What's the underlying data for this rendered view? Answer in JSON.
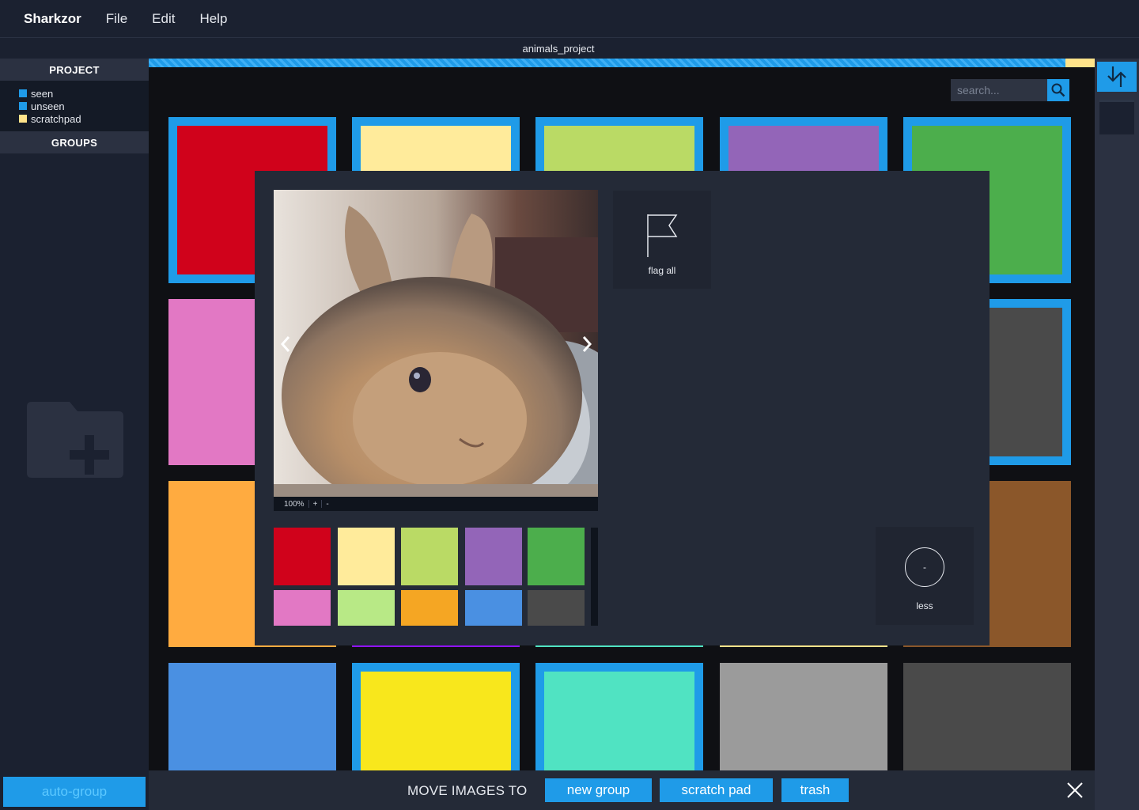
{
  "app": {
    "brand": "Sharkzor",
    "menu": [
      "File",
      "Edit",
      "Help"
    ],
    "project_title": "animals_project"
  },
  "sidebar": {
    "project_header": "PROJECT",
    "legend": [
      {
        "label": "seen",
        "color": "#1f9be8"
      },
      {
        "label": "unseen",
        "color": "#1f9be8"
      },
      {
        "label": "scratchpad",
        "color": "#ffe38a"
      }
    ],
    "groups_header": "GROUPS",
    "add_group_icon": "folder-plus-icon",
    "auto_group_label": "auto-group"
  },
  "search": {
    "placeholder": "search...",
    "icon": "search-icon"
  },
  "grid": {
    "accent": "#1f9be8",
    "tiles": [
      {
        "color": "#d0021b",
        "selected": true
      },
      {
        "color": "#ffeb9b",
        "selected": true
      },
      {
        "color": "#bada65",
        "selected": true
      },
      {
        "color": "#9365b8",
        "selected": true
      },
      {
        "color": "#4cae4c",
        "selected": true
      },
      {
        "color": "#e278c4",
        "selected": false
      },
      {
        "color": "#b8e986",
        "selected": false
      },
      {
        "color": "#f5a623",
        "selected": false
      },
      {
        "color": "#4a90e2",
        "selected": false
      },
      {
        "color": "#4a4a4a",
        "selected": true
      },
      {
        "color": "#ffab40",
        "selected": false
      },
      {
        "color": "#9013fe",
        "selected": false
      },
      {
        "color": "#50e3c2",
        "selected": false
      },
      {
        "color": "#ffe38a",
        "selected": false
      },
      {
        "color": "#8b572a",
        "selected": false
      },
      {
        "color": "#4a90e2",
        "selected": false
      },
      {
        "color": "#f8e71c",
        "selected": true
      },
      {
        "color": "#50e3c2",
        "selected": true
      },
      {
        "color": "#9b9b9b",
        "selected": false
      },
      {
        "color": "#4a4a4a",
        "selected": false
      }
    ]
  },
  "modal": {
    "zoom": "100%",
    "zoom_in": "+",
    "zoom_out": "-",
    "flag_label": "flag all",
    "less_symbol": "-",
    "less_label": "less",
    "palette": [
      "#d0021b",
      "#ffeb9b",
      "#bada65",
      "#9365b8",
      "#4cae4c",
      "#e278c4",
      "#b8e986",
      "#f5a623",
      "#4a90e2",
      "#4a4a4a"
    ]
  },
  "actionbar": {
    "label": "MOVE IMAGES TO",
    "buttons": [
      "new group",
      "scratch pad",
      "trash"
    ]
  }
}
